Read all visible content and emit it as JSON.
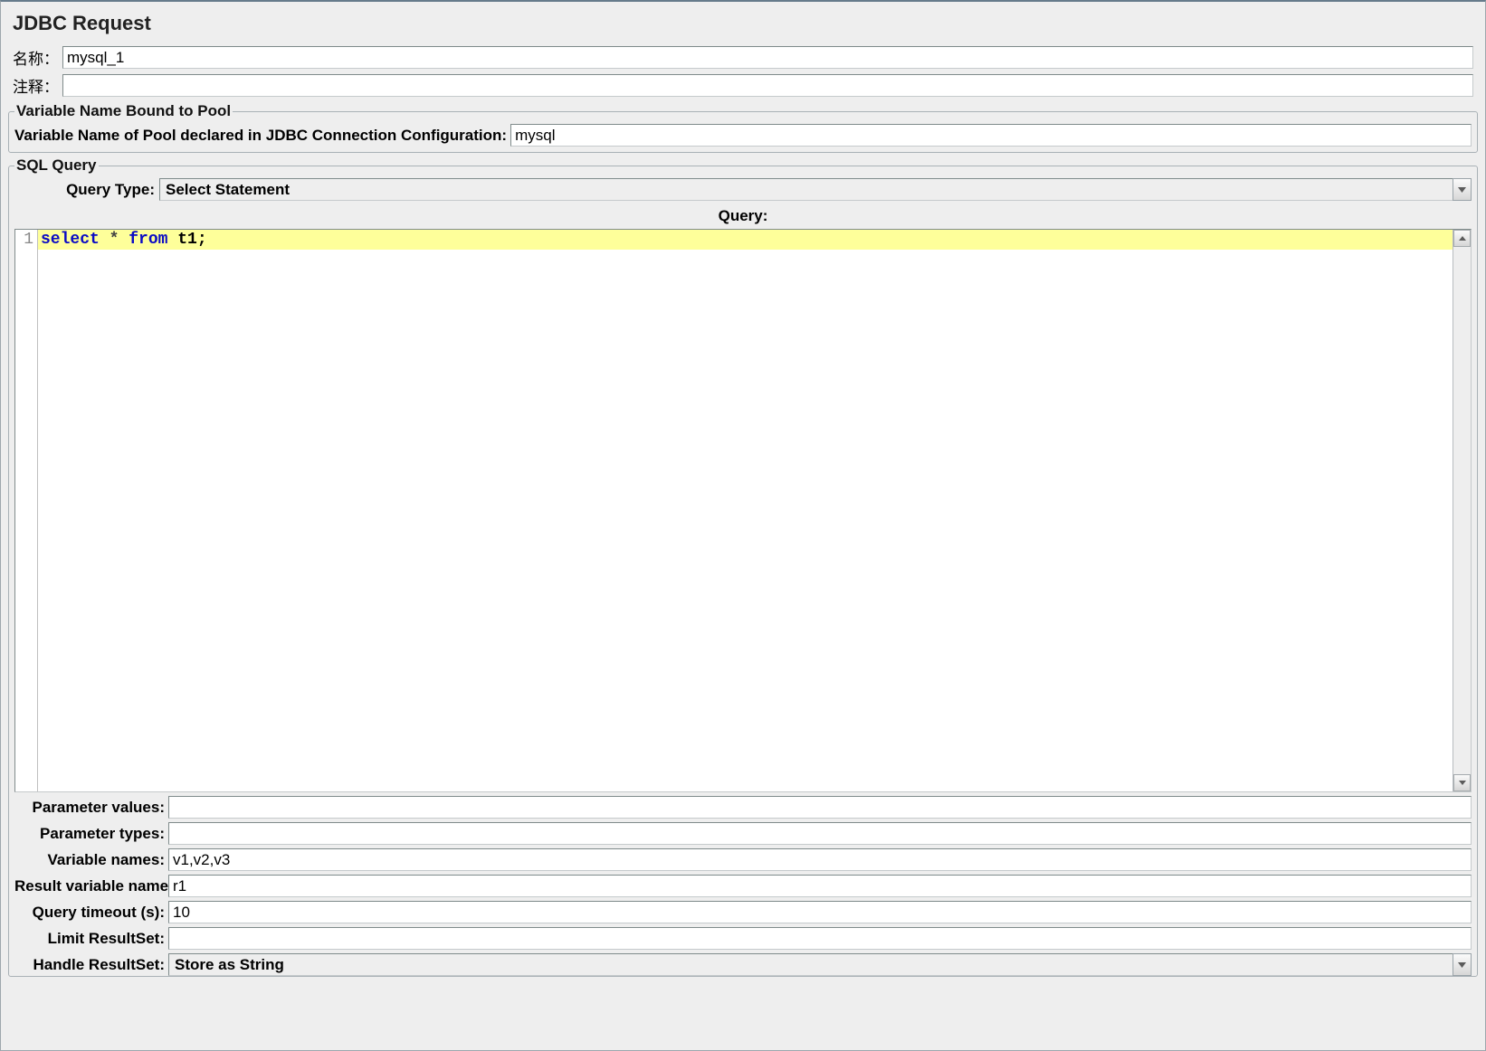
{
  "title": "JDBC Request",
  "name_label": "名称：",
  "name_value": "mysql_1",
  "comment_label": "注释：",
  "comment_value": "",
  "pool_fieldset": {
    "legend": "Variable Name Bound to Pool",
    "field_label": "Variable Name of Pool declared in JDBC Connection Configuration:",
    "field_value": "mysql"
  },
  "sql_fieldset": {
    "legend": "SQL Query",
    "query_type_label": "Query Type:",
    "query_type_value": "Select Statement",
    "query_header": "Query:",
    "code_line_number": "1",
    "code": {
      "kw1": "select",
      "op": " * ",
      "kw2": "from",
      "sp": " ",
      "id": "t1",
      "semi": ";"
    },
    "rows": {
      "param_values_label": "Parameter values:",
      "param_values": "",
      "param_types_label": "Parameter types:",
      "param_types": "",
      "variable_names_label": "Variable names:",
      "variable_names": "v1,v2,v3",
      "result_var_label": "Result variable name:",
      "result_var": "r1",
      "query_timeout_label": "Query timeout (s):",
      "query_timeout": "10",
      "limit_rs_label": "Limit ResultSet:",
      "limit_rs": "",
      "handle_rs_label": "Handle ResultSet:",
      "handle_rs_value": "Store as String"
    }
  }
}
